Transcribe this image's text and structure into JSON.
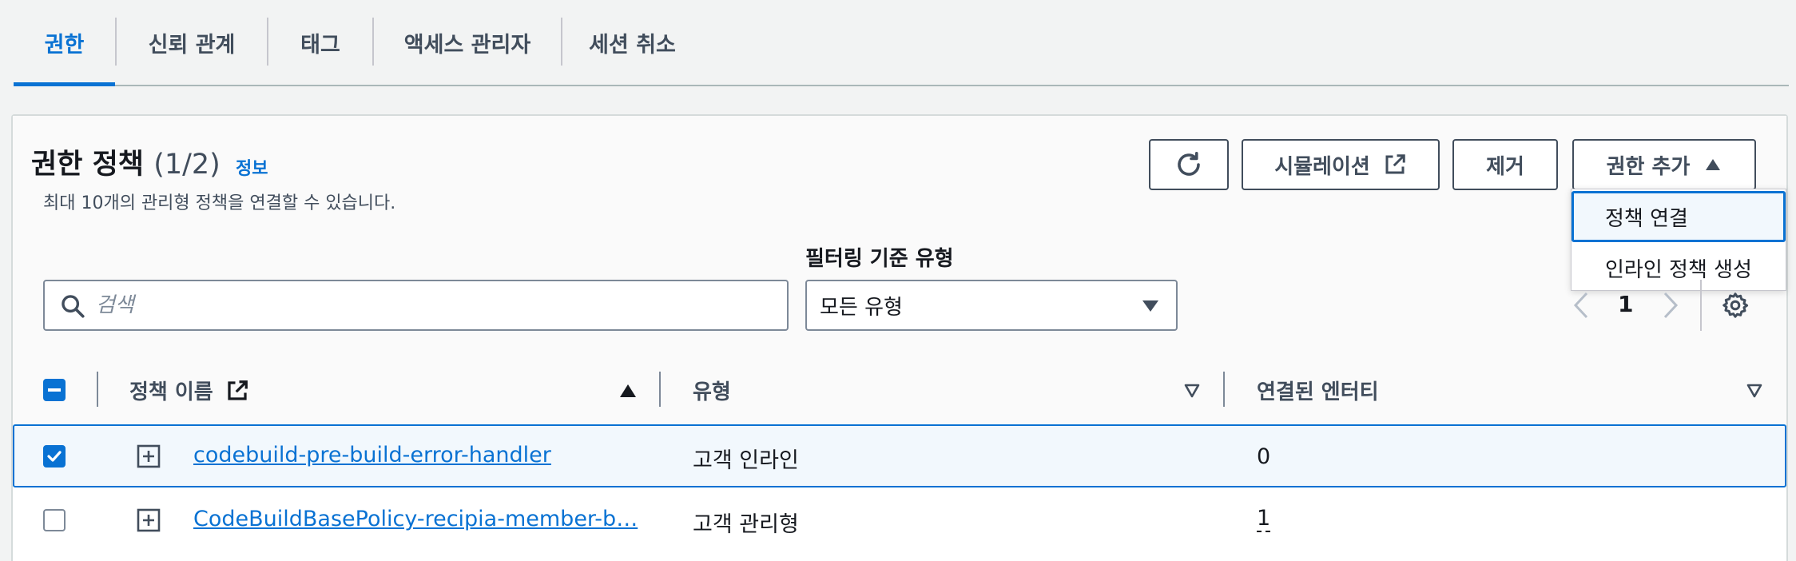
{
  "tabs": [
    {
      "label": "권한",
      "active": true
    },
    {
      "label": "신뢰 관계",
      "active": false
    },
    {
      "label": "태그",
      "active": false
    },
    {
      "label": "액세스 관리자",
      "active": false
    },
    {
      "label": "세션 취소",
      "active": false
    }
  ],
  "panel": {
    "title": "권한 정책",
    "count": "(1/2)",
    "info_link": "정보",
    "subtitle": "최대 10개의 관리형 정책을 연결할 수 있습니다."
  },
  "actions": {
    "refresh_icon": "refresh-icon",
    "simulation_label": "시뮬레이션",
    "remove_label": "제거",
    "add_permissions_label": "권한 추가"
  },
  "dropdown": {
    "items": [
      {
        "label": "정책 연결",
        "focused": true
      },
      {
        "label": "인라인 정책 생성",
        "focused": false
      }
    ]
  },
  "filter": {
    "search_placeholder": "검색",
    "type_label": "필터링 기준 유형",
    "type_value": "모든 유형"
  },
  "pagination": {
    "current_page": "1"
  },
  "table": {
    "columns": [
      "정책 이름",
      "유형",
      "연결된 엔터티"
    ],
    "rows": [
      {
        "name": "codebuild-pre-build-error-handler",
        "type": "고객 인라인",
        "entities": "0",
        "selected": true
      },
      {
        "name": "CodeBuildBasePolicy-recipia-member-b…",
        "type": "고객 관리형",
        "entities": "1",
        "selected": false
      }
    ]
  },
  "colors": {
    "accent": "#0972d3",
    "text": "#16191f",
    "secondary_text": "#414d5c",
    "border": "#7d8998"
  }
}
